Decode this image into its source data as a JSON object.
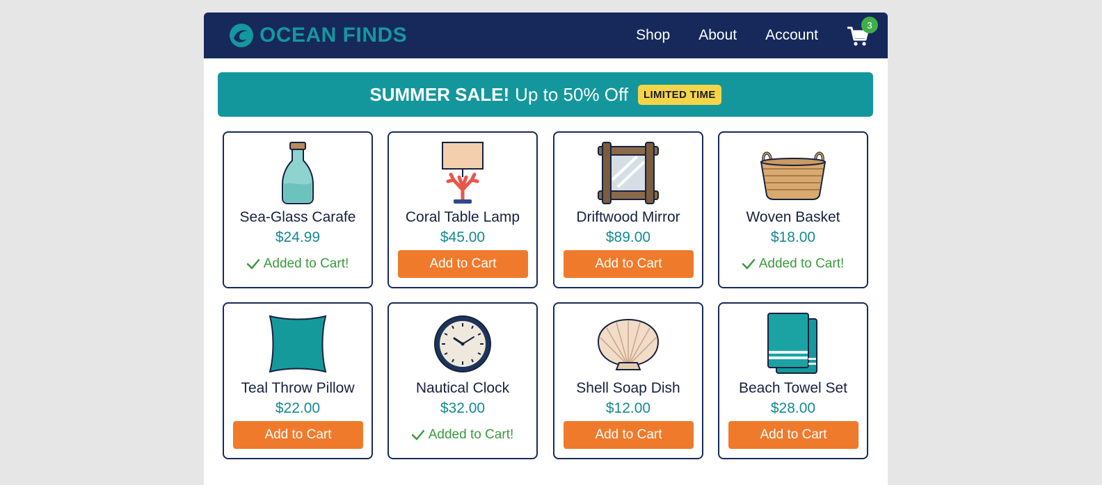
{
  "header": {
    "brand": "OCEAN FINDS",
    "nav": [
      "Shop",
      "About",
      "Account"
    ],
    "cart_count": "3"
  },
  "banner": {
    "strong": "SUMMER SALE!",
    "text": "Up to 50% Off",
    "badge": "LIMITED TIME"
  },
  "add_label": "Add to Cart",
  "added_label": "Added to Cart!",
  "colors": {
    "navbar": "#16295a",
    "brand": "#1597a0",
    "banner": "#14979c",
    "badge": "#f5d547",
    "button": "#f07a2b",
    "price": "#138a91",
    "added": "#3a9a3c",
    "cart_badge": "#3fae4a"
  },
  "products": [
    {
      "name": "Sea-Glass Carafe",
      "price": "$24.99",
      "added": true,
      "icon": "carafe-icon"
    },
    {
      "name": "Coral Table Lamp",
      "price": "$45.00",
      "added": false,
      "icon": "coral-lamp-icon"
    },
    {
      "name": "Driftwood Mirror",
      "price": "$89.00",
      "added": false,
      "icon": "driftwood-mirror-icon"
    },
    {
      "name": "Woven Basket",
      "price": "$18.00",
      "added": true,
      "icon": "woven-basket-icon"
    },
    {
      "name": "Teal Throw Pillow",
      "price": "$22.00",
      "added": false,
      "icon": "throw-pillow-icon"
    },
    {
      "name": "Nautical Clock",
      "price": "$32.00",
      "added": true,
      "icon": "clock-icon"
    },
    {
      "name": "Shell Soap Dish",
      "price": "$12.00",
      "added": false,
      "icon": "shell-icon"
    },
    {
      "name": "Beach Towel Set",
      "price": "$28.00",
      "added": false,
      "icon": "towel-icon"
    }
  ]
}
